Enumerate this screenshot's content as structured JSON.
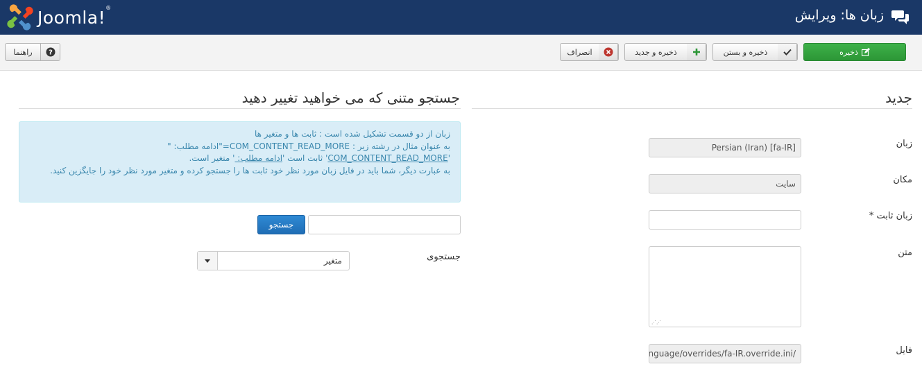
{
  "header": {
    "logo_text": "Joomla!",
    "logo_reg": "®",
    "page_title": "زبان ها: ویرایش",
    "title_icon": "comments-icon"
  },
  "toolbar": {
    "save_label": "ذخیره",
    "save_close_label": "ذخیره و بستن",
    "save_new_label": "ذخیره و جدید",
    "cancel_label": "انصراف",
    "help_label": "راهنما"
  },
  "form": {
    "section_title": "جدید",
    "language_label": "زبان",
    "language_value": "Persian (Iran) [fa-IR]",
    "location_label": "مکان",
    "location_value": "سایت",
    "constant_label": "زبان ثابت *",
    "constant_value": "",
    "text_label": "متن",
    "text_value": "",
    "file_label": "فایل",
    "file_value": "nguage/overrides/fa-IR.override.ini/"
  },
  "search": {
    "section_title": "جستجو متنی که می خواهید تغییر دهید",
    "info_line1": "زبان از دو قسمت تشکیل شده است : ثابت ها و متغیر ها",
    "info_line2": "به عنوان مثال در رشته زیر : COM_CONTENT_READ_MORE=\"ادامه مطلب: \"",
    "info_line3_a": "'",
    "info_line3_const": "COM_CONTENT_READ_MORE",
    "info_line3_b": "' ثابت است '",
    "info_line3_var": "ادامه مطلب: ",
    "info_line3_c": "' متغیر است.",
    "info_line4": "به عبارت دیگر، شما باید در فایل زبان مورد نظر خود ثابت ها را جستجو کرده و متغیر مورد نظر خود را جایگزین کنید.",
    "search_input_value": "",
    "search_button_label": "جستجو",
    "search_in_label": "جستجوی",
    "search_in_value": "متغیر"
  },
  "colors": {
    "header_bg": "#1a3867",
    "save_green": "#2c9636",
    "search_blue": "#1f6db5",
    "info_bg": "#d9edf7",
    "info_text": "#3a87ad"
  }
}
